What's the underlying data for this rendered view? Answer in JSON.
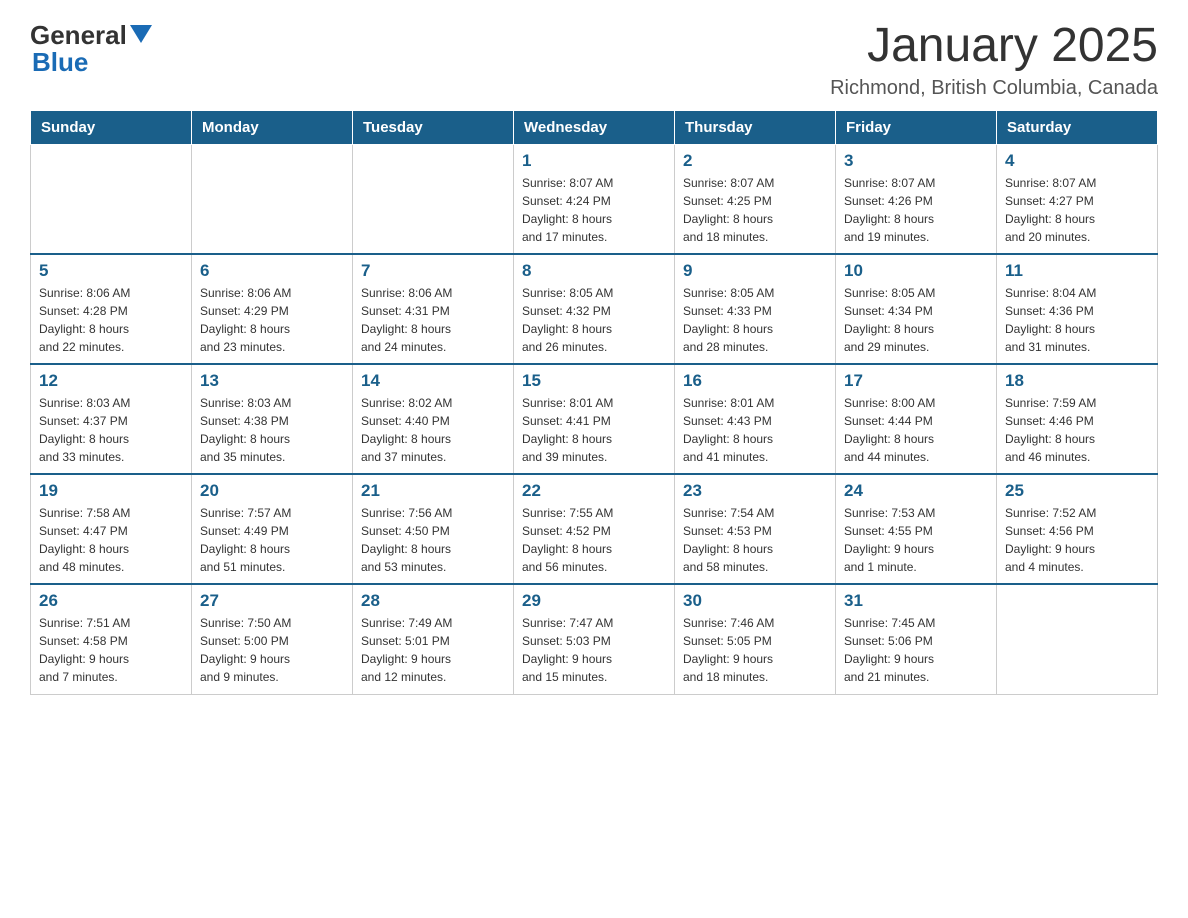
{
  "logo": {
    "general": "General",
    "blue": "Blue"
  },
  "title": "January 2025",
  "subtitle": "Richmond, British Columbia, Canada",
  "days_of_week": [
    "Sunday",
    "Monday",
    "Tuesday",
    "Wednesday",
    "Thursday",
    "Friday",
    "Saturday"
  ],
  "weeks": [
    [
      {
        "day": "",
        "info": ""
      },
      {
        "day": "",
        "info": ""
      },
      {
        "day": "",
        "info": ""
      },
      {
        "day": "1",
        "info": "Sunrise: 8:07 AM\nSunset: 4:24 PM\nDaylight: 8 hours\nand 17 minutes."
      },
      {
        "day": "2",
        "info": "Sunrise: 8:07 AM\nSunset: 4:25 PM\nDaylight: 8 hours\nand 18 minutes."
      },
      {
        "day": "3",
        "info": "Sunrise: 8:07 AM\nSunset: 4:26 PM\nDaylight: 8 hours\nand 19 minutes."
      },
      {
        "day": "4",
        "info": "Sunrise: 8:07 AM\nSunset: 4:27 PM\nDaylight: 8 hours\nand 20 minutes."
      }
    ],
    [
      {
        "day": "5",
        "info": "Sunrise: 8:06 AM\nSunset: 4:28 PM\nDaylight: 8 hours\nand 22 minutes."
      },
      {
        "day": "6",
        "info": "Sunrise: 8:06 AM\nSunset: 4:29 PM\nDaylight: 8 hours\nand 23 minutes."
      },
      {
        "day": "7",
        "info": "Sunrise: 8:06 AM\nSunset: 4:31 PM\nDaylight: 8 hours\nand 24 minutes."
      },
      {
        "day": "8",
        "info": "Sunrise: 8:05 AM\nSunset: 4:32 PM\nDaylight: 8 hours\nand 26 minutes."
      },
      {
        "day": "9",
        "info": "Sunrise: 8:05 AM\nSunset: 4:33 PM\nDaylight: 8 hours\nand 28 minutes."
      },
      {
        "day": "10",
        "info": "Sunrise: 8:05 AM\nSunset: 4:34 PM\nDaylight: 8 hours\nand 29 minutes."
      },
      {
        "day": "11",
        "info": "Sunrise: 8:04 AM\nSunset: 4:36 PM\nDaylight: 8 hours\nand 31 minutes."
      }
    ],
    [
      {
        "day": "12",
        "info": "Sunrise: 8:03 AM\nSunset: 4:37 PM\nDaylight: 8 hours\nand 33 minutes."
      },
      {
        "day": "13",
        "info": "Sunrise: 8:03 AM\nSunset: 4:38 PM\nDaylight: 8 hours\nand 35 minutes."
      },
      {
        "day": "14",
        "info": "Sunrise: 8:02 AM\nSunset: 4:40 PM\nDaylight: 8 hours\nand 37 minutes."
      },
      {
        "day": "15",
        "info": "Sunrise: 8:01 AM\nSunset: 4:41 PM\nDaylight: 8 hours\nand 39 minutes."
      },
      {
        "day": "16",
        "info": "Sunrise: 8:01 AM\nSunset: 4:43 PM\nDaylight: 8 hours\nand 41 minutes."
      },
      {
        "day": "17",
        "info": "Sunrise: 8:00 AM\nSunset: 4:44 PM\nDaylight: 8 hours\nand 44 minutes."
      },
      {
        "day": "18",
        "info": "Sunrise: 7:59 AM\nSunset: 4:46 PM\nDaylight: 8 hours\nand 46 minutes."
      }
    ],
    [
      {
        "day": "19",
        "info": "Sunrise: 7:58 AM\nSunset: 4:47 PM\nDaylight: 8 hours\nand 48 minutes."
      },
      {
        "day": "20",
        "info": "Sunrise: 7:57 AM\nSunset: 4:49 PM\nDaylight: 8 hours\nand 51 minutes."
      },
      {
        "day": "21",
        "info": "Sunrise: 7:56 AM\nSunset: 4:50 PM\nDaylight: 8 hours\nand 53 minutes."
      },
      {
        "day": "22",
        "info": "Sunrise: 7:55 AM\nSunset: 4:52 PM\nDaylight: 8 hours\nand 56 minutes."
      },
      {
        "day": "23",
        "info": "Sunrise: 7:54 AM\nSunset: 4:53 PM\nDaylight: 8 hours\nand 58 minutes."
      },
      {
        "day": "24",
        "info": "Sunrise: 7:53 AM\nSunset: 4:55 PM\nDaylight: 9 hours\nand 1 minute."
      },
      {
        "day": "25",
        "info": "Sunrise: 7:52 AM\nSunset: 4:56 PM\nDaylight: 9 hours\nand 4 minutes."
      }
    ],
    [
      {
        "day": "26",
        "info": "Sunrise: 7:51 AM\nSunset: 4:58 PM\nDaylight: 9 hours\nand 7 minutes."
      },
      {
        "day": "27",
        "info": "Sunrise: 7:50 AM\nSunset: 5:00 PM\nDaylight: 9 hours\nand 9 minutes."
      },
      {
        "day": "28",
        "info": "Sunrise: 7:49 AM\nSunset: 5:01 PM\nDaylight: 9 hours\nand 12 minutes."
      },
      {
        "day": "29",
        "info": "Sunrise: 7:47 AM\nSunset: 5:03 PM\nDaylight: 9 hours\nand 15 minutes."
      },
      {
        "day": "30",
        "info": "Sunrise: 7:46 AM\nSunset: 5:05 PM\nDaylight: 9 hours\nand 18 minutes."
      },
      {
        "day": "31",
        "info": "Sunrise: 7:45 AM\nSunset: 5:06 PM\nDaylight: 9 hours\nand 21 minutes."
      },
      {
        "day": "",
        "info": ""
      }
    ]
  ]
}
